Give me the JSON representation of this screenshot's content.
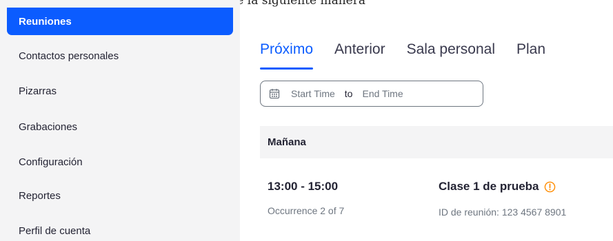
{
  "document": {
    "caption": "lace. Luego del proceso se visualizará de la siguiente manera"
  },
  "sidebar": {
    "items": [
      {
        "label": "Reuniones",
        "active": true
      },
      {
        "label": "Contactos personales"
      },
      {
        "label": "Pizarras"
      },
      {
        "label": "Grabaciones"
      },
      {
        "label": "Configuración"
      },
      {
        "label": "Reportes"
      },
      {
        "label": "Perfil de cuenta"
      }
    ]
  },
  "main": {
    "tabs": [
      {
        "label": "Próximo",
        "active": true
      },
      {
        "label": "Anterior"
      },
      {
        "label": "Sala personal"
      },
      {
        "label": "Plan"
      }
    ],
    "date_range": {
      "start_placeholder": "Start Time",
      "separator": "to",
      "end_placeholder": "End Time"
    },
    "group_header": "Mañana",
    "meeting": {
      "time": "13:00 - 15:00",
      "occurrence": "Occurrence 2 of 7",
      "title": "Clase 1 de prueba",
      "meeting_id": "ID de reunión: 123 4567 8901"
    }
  },
  "colors": {
    "accent": "#0b5cff",
    "warning": "#ff8c00"
  }
}
